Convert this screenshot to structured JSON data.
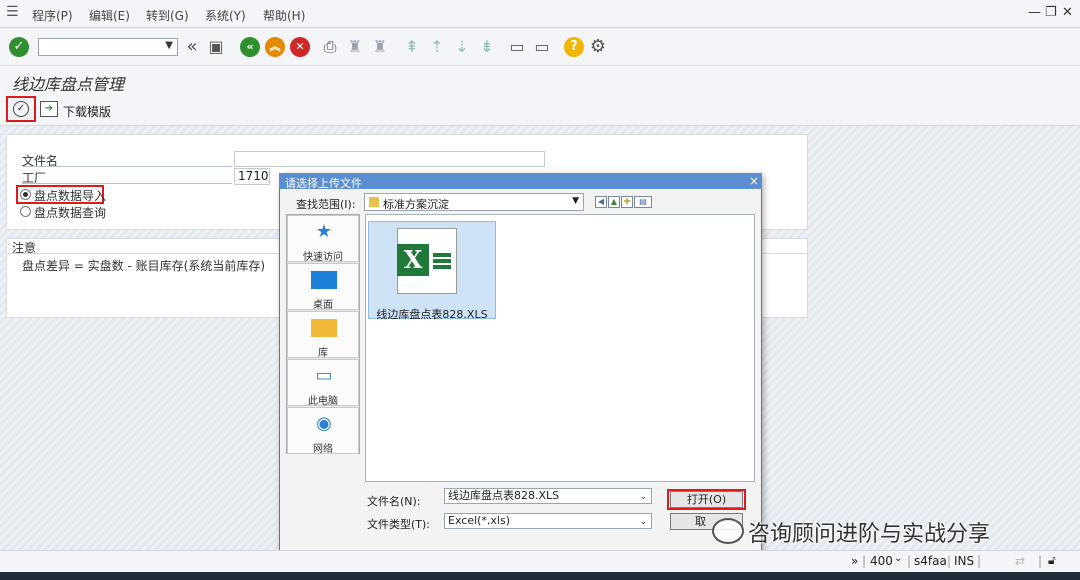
{
  "menu": {
    "items": [
      "程序(P)",
      "编辑(E)",
      "转到(G)",
      "系统(Y)",
      "帮助(H)"
    ]
  },
  "page": {
    "title": "线边库盘点管理",
    "download_template_label": "下载模版"
  },
  "selection": {
    "filename_label": "文件名",
    "plant_label": "工厂",
    "plant_value": "1710",
    "radio_import_label": "盘点数据导入",
    "radio_query_label": "盘点数据查询",
    "radio_import_selected": true
  },
  "note": {
    "header": "注意",
    "text": "盘点差异 = 实盘数 - 账目库存(系统当前库存)"
  },
  "dialog": {
    "title": "请选择上传文件",
    "close_symbol": "×",
    "lookin_label": "查找范围(I):",
    "lookin_value": "标准方案沉淀",
    "places": [
      {
        "label": "快速访问",
        "icon": "star-icon"
      },
      {
        "label": "桌面",
        "icon": "desktop-icon"
      },
      {
        "label": "库",
        "icon": "library-icon"
      },
      {
        "label": "此电脑",
        "icon": "computer-icon"
      },
      {
        "label": "网络",
        "icon": "network-icon"
      }
    ],
    "file_item": "线边库盘点表828.XLS",
    "filename_label": "文件名(N):",
    "filename_value": "线边库盘点表828.XLS",
    "filetype_label": "文件类型(T):",
    "filetype_value": "Excel(*.xls)",
    "open_label": "打开(O)",
    "cancel_label": "取"
  },
  "watermark": "咨询顾问进阶与实战分享",
  "status": {
    "client": "400",
    "system": "s4faa",
    "mode": "INS"
  },
  "colors": {
    "sap_green": "#2f8f2f",
    "highlight_red": "#e01919",
    "dialog_title_blue": "#5b8dd1"
  }
}
